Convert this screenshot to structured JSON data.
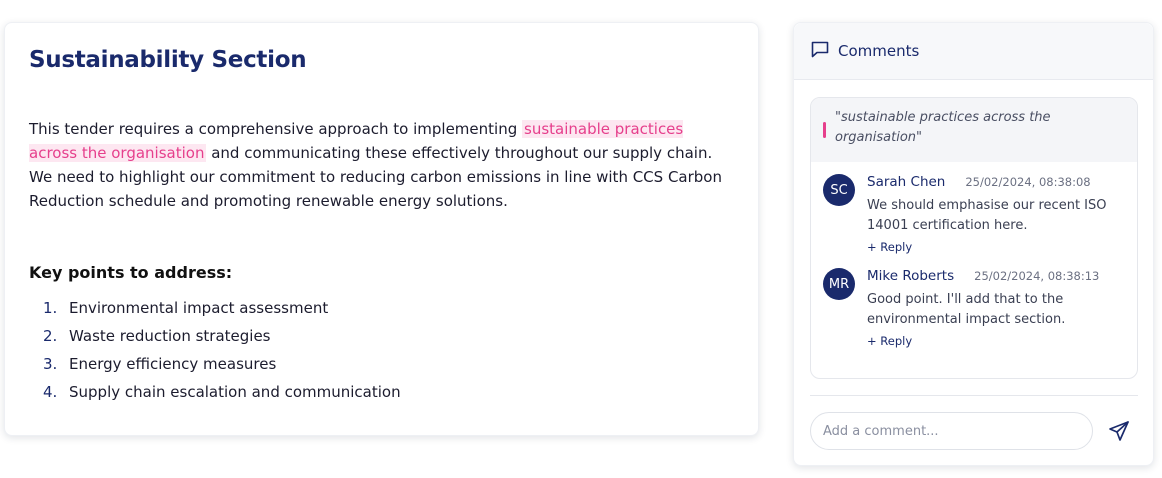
{
  "document": {
    "title": "Sustainability Section",
    "para_before": "This tender requires a comprehensive approach to implementing ",
    "para_highlight": "sustainable practices across the organisation",
    "para_after": " and communicating these effectively throughout our supply chain. We need to highlight our commitment to reducing carbon emissions in line with CCS Carbon Reduction schedule and promoting renewable energy solutions.",
    "key_points_heading": "Key points to address:",
    "key_points": [
      {
        "num": "1.",
        "text": "Environmental impact assessment"
      },
      {
        "num": "2.",
        "text": "Waste reduction strategies"
      },
      {
        "num": "3.",
        "text": "Energy efficiency measures"
      },
      {
        "num": "4.",
        "text": "Supply chain escalation and communication"
      }
    ]
  },
  "comments_panel": {
    "title": "Comments",
    "icon": "comment-icon",
    "quote": "\"sustainable practices across the organisation\"",
    "comments": [
      {
        "initials": "SC",
        "author": "Sarah Chen",
        "time": "25/02/2024, 08:38:08",
        "text": "We should emphasise our recent ISO 14001 certification here.",
        "reply": "+ Reply"
      },
      {
        "initials": "MR",
        "author": "Mike Roberts",
        "time": "25/02/2024, 08:38:13",
        "text": "Good point. I'll add that to the environmental impact section.",
        "reply": "+ Reply"
      }
    ],
    "input_placeholder": "Add a comment...",
    "send_icon": "send-icon"
  },
  "colors": {
    "accent": "#1a2a6c",
    "highlight_text": "#e63f8c",
    "highlight_bg": "#fde7f1"
  }
}
